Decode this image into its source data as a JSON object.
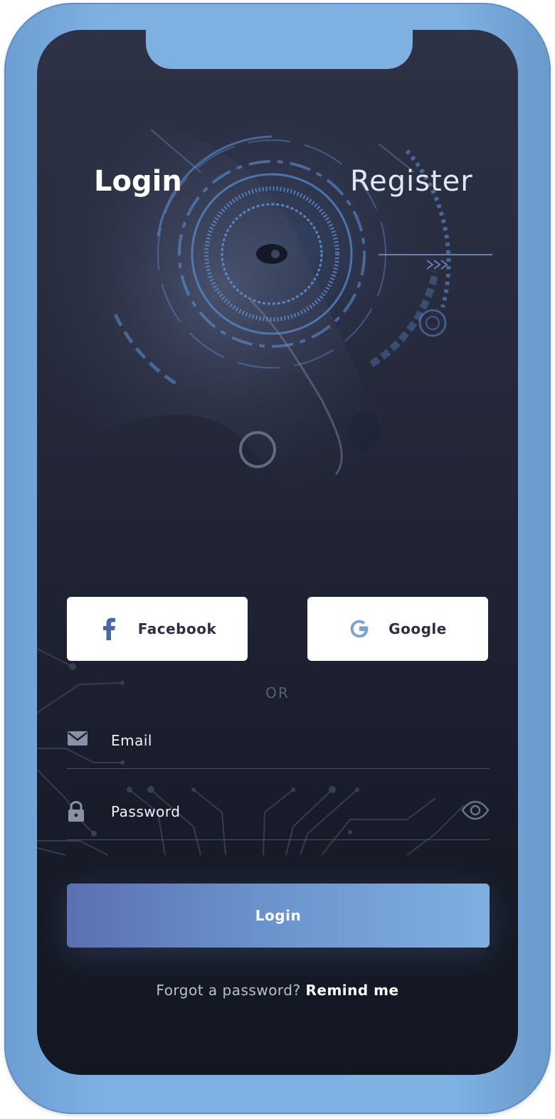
{
  "tabs": {
    "login_label": "Login",
    "register_label": "Register"
  },
  "social": {
    "facebook_label": "Facebook",
    "google_label": "Google"
  },
  "divider_label": "OR",
  "form": {
    "email_placeholder": "Email",
    "email_value": "",
    "password_placeholder": "Password",
    "password_value": "",
    "submit_label": "Login"
  },
  "footer": {
    "forgot_text": "Forgot a password?",
    "remind_label": "Remind me"
  },
  "icons": {
    "facebook": "facebook-icon",
    "google": "google-icon",
    "email": "envelope-icon",
    "password": "lock-icon",
    "reveal": "eye-icon"
  },
  "colors": {
    "frame": "#7eb0e2",
    "background_top": "#2e3246",
    "background_bottom": "#131722",
    "accent": "#6a92cc",
    "facebook": "#4a67a8",
    "google": "#7aa2d6"
  }
}
